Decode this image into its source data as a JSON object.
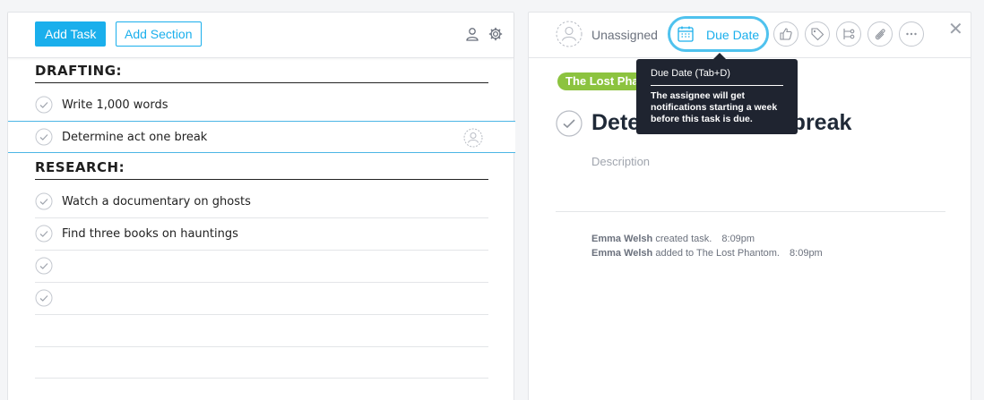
{
  "toolbar": {
    "add_task_label": "Add Task",
    "add_section_label": "Add Section"
  },
  "sections": [
    {
      "title": "DRAFTING:",
      "tasks": [
        {
          "name": "Write 1,000 words"
        },
        {
          "name": "Determine act one break",
          "selected": true
        }
      ]
    },
    {
      "title": "RESEARCH:",
      "tasks": [
        {
          "name": "Watch a documentary on ghosts"
        },
        {
          "name": "Find three books on hauntings"
        },
        {
          "name": ""
        },
        {
          "name": ""
        }
      ]
    }
  ],
  "detail": {
    "assignee_label": "Unassigned",
    "due_date_label": "Due Date",
    "project_tag": "The Lost Phantom",
    "task_title": "Determine act one break",
    "description_placeholder": "Description",
    "stories": [
      {
        "author": "Emma Welsh",
        "action": "created task.",
        "time": "8:09pm"
      },
      {
        "author": "Emma Welsh",
        "action": "added to The Lost Phantom.",
        "time": "8:09pm"
      }
    ]
  },
  "tooltip": {
    "title": "Due Date (Tab+D)",
    "body": "The assignee will get notifications starting a week before this task is due."
  },
  "colors": {
    "accent": "#1aafec",
    "project": "#8cc33f",
    "tooltip_bg": "#1f2430"
  },
  "icons": [
    "user-icon",
    "gear-icon",
    "check-icon",
    "calendar-icon",
    "thumbs-up-icon",
    "tag-icon",
    "subtask-icon",
    "paperclip-icon",
    "more-icon",
    "close-icon"
  ]
}
